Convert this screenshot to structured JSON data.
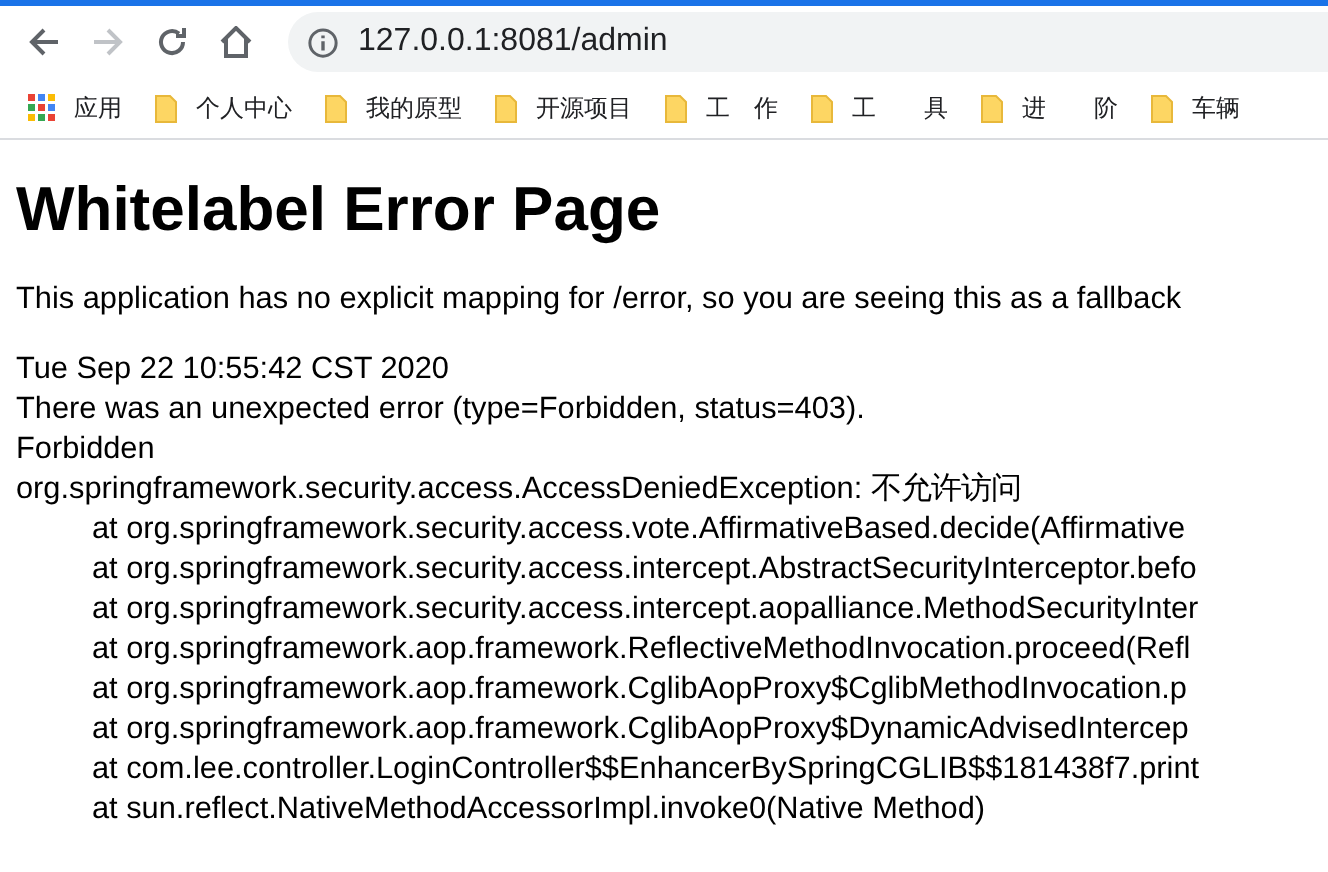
{
  "browser": {
    "address": "127.0.0.1:8081/admin",
    "back_enabled": true,
    "forward_enabled": false,
    "bookmarks": [
      {
        "kind": "apps",
        "label": "应用"
      },
      {
        "kind": "folder",
        "label": "个人中心"
      },
      {
        "kind": "folder",
        "label": "我的原型"
      },
      {
        "kind": "folder",
        "label": "开源项目"
      },
      {
        "kind": "folder",
        "label": "工　作"
      },
      {
        "kind": "folder",
        "label": "工　　具"
      },
      {
        "kind": "folder",
        "label": "进　　阶"
      },
      {
        "kind": "folder",
        "label": "车辆"
      }
    ]
  },
  "page": {
    "title": "Whitelabel Error Page",
    "message": "This application has no explicit mapping for /error, so you are seeing this as a fallback",
    "details": [
      "Tue Sep 22 10:55:42 CST 2020",
      "There was an unexpected error (type=Forbidden, status=403).",
      "Forbidden",
      "org.springframework.security.access.AccessDeniedException: 不允许访问"
    ],
    "stack": [
      "at org.springframework.security.access.vote.AffirmativeBased.decide(Affirmative",
      "at org.springframework.security.access.intercept.AbstractSecurityInterceptor.befo",
      "at org.springframework.security.access.intercept.aopalliance.MethodSecurityInter",
      "at org.springframework.aop.framework.ReflectiveMethodInvocation.proceed(Refl",
      "at org.springframework.aop.framework.CglibAopProxy$CglibMethodInvocation.p",
      "at org.springframework.aop.framework.CglibAopProxy$DynamicAdvisedIntercep",
      "at com.lee.controller.LoginController$$EnhancerBySpringCGLIB$$181438f7.print",
      "at sun.reflect.NativeMethodAccessorImpl.invoke0(Native Method)"
    ]
  }
}
